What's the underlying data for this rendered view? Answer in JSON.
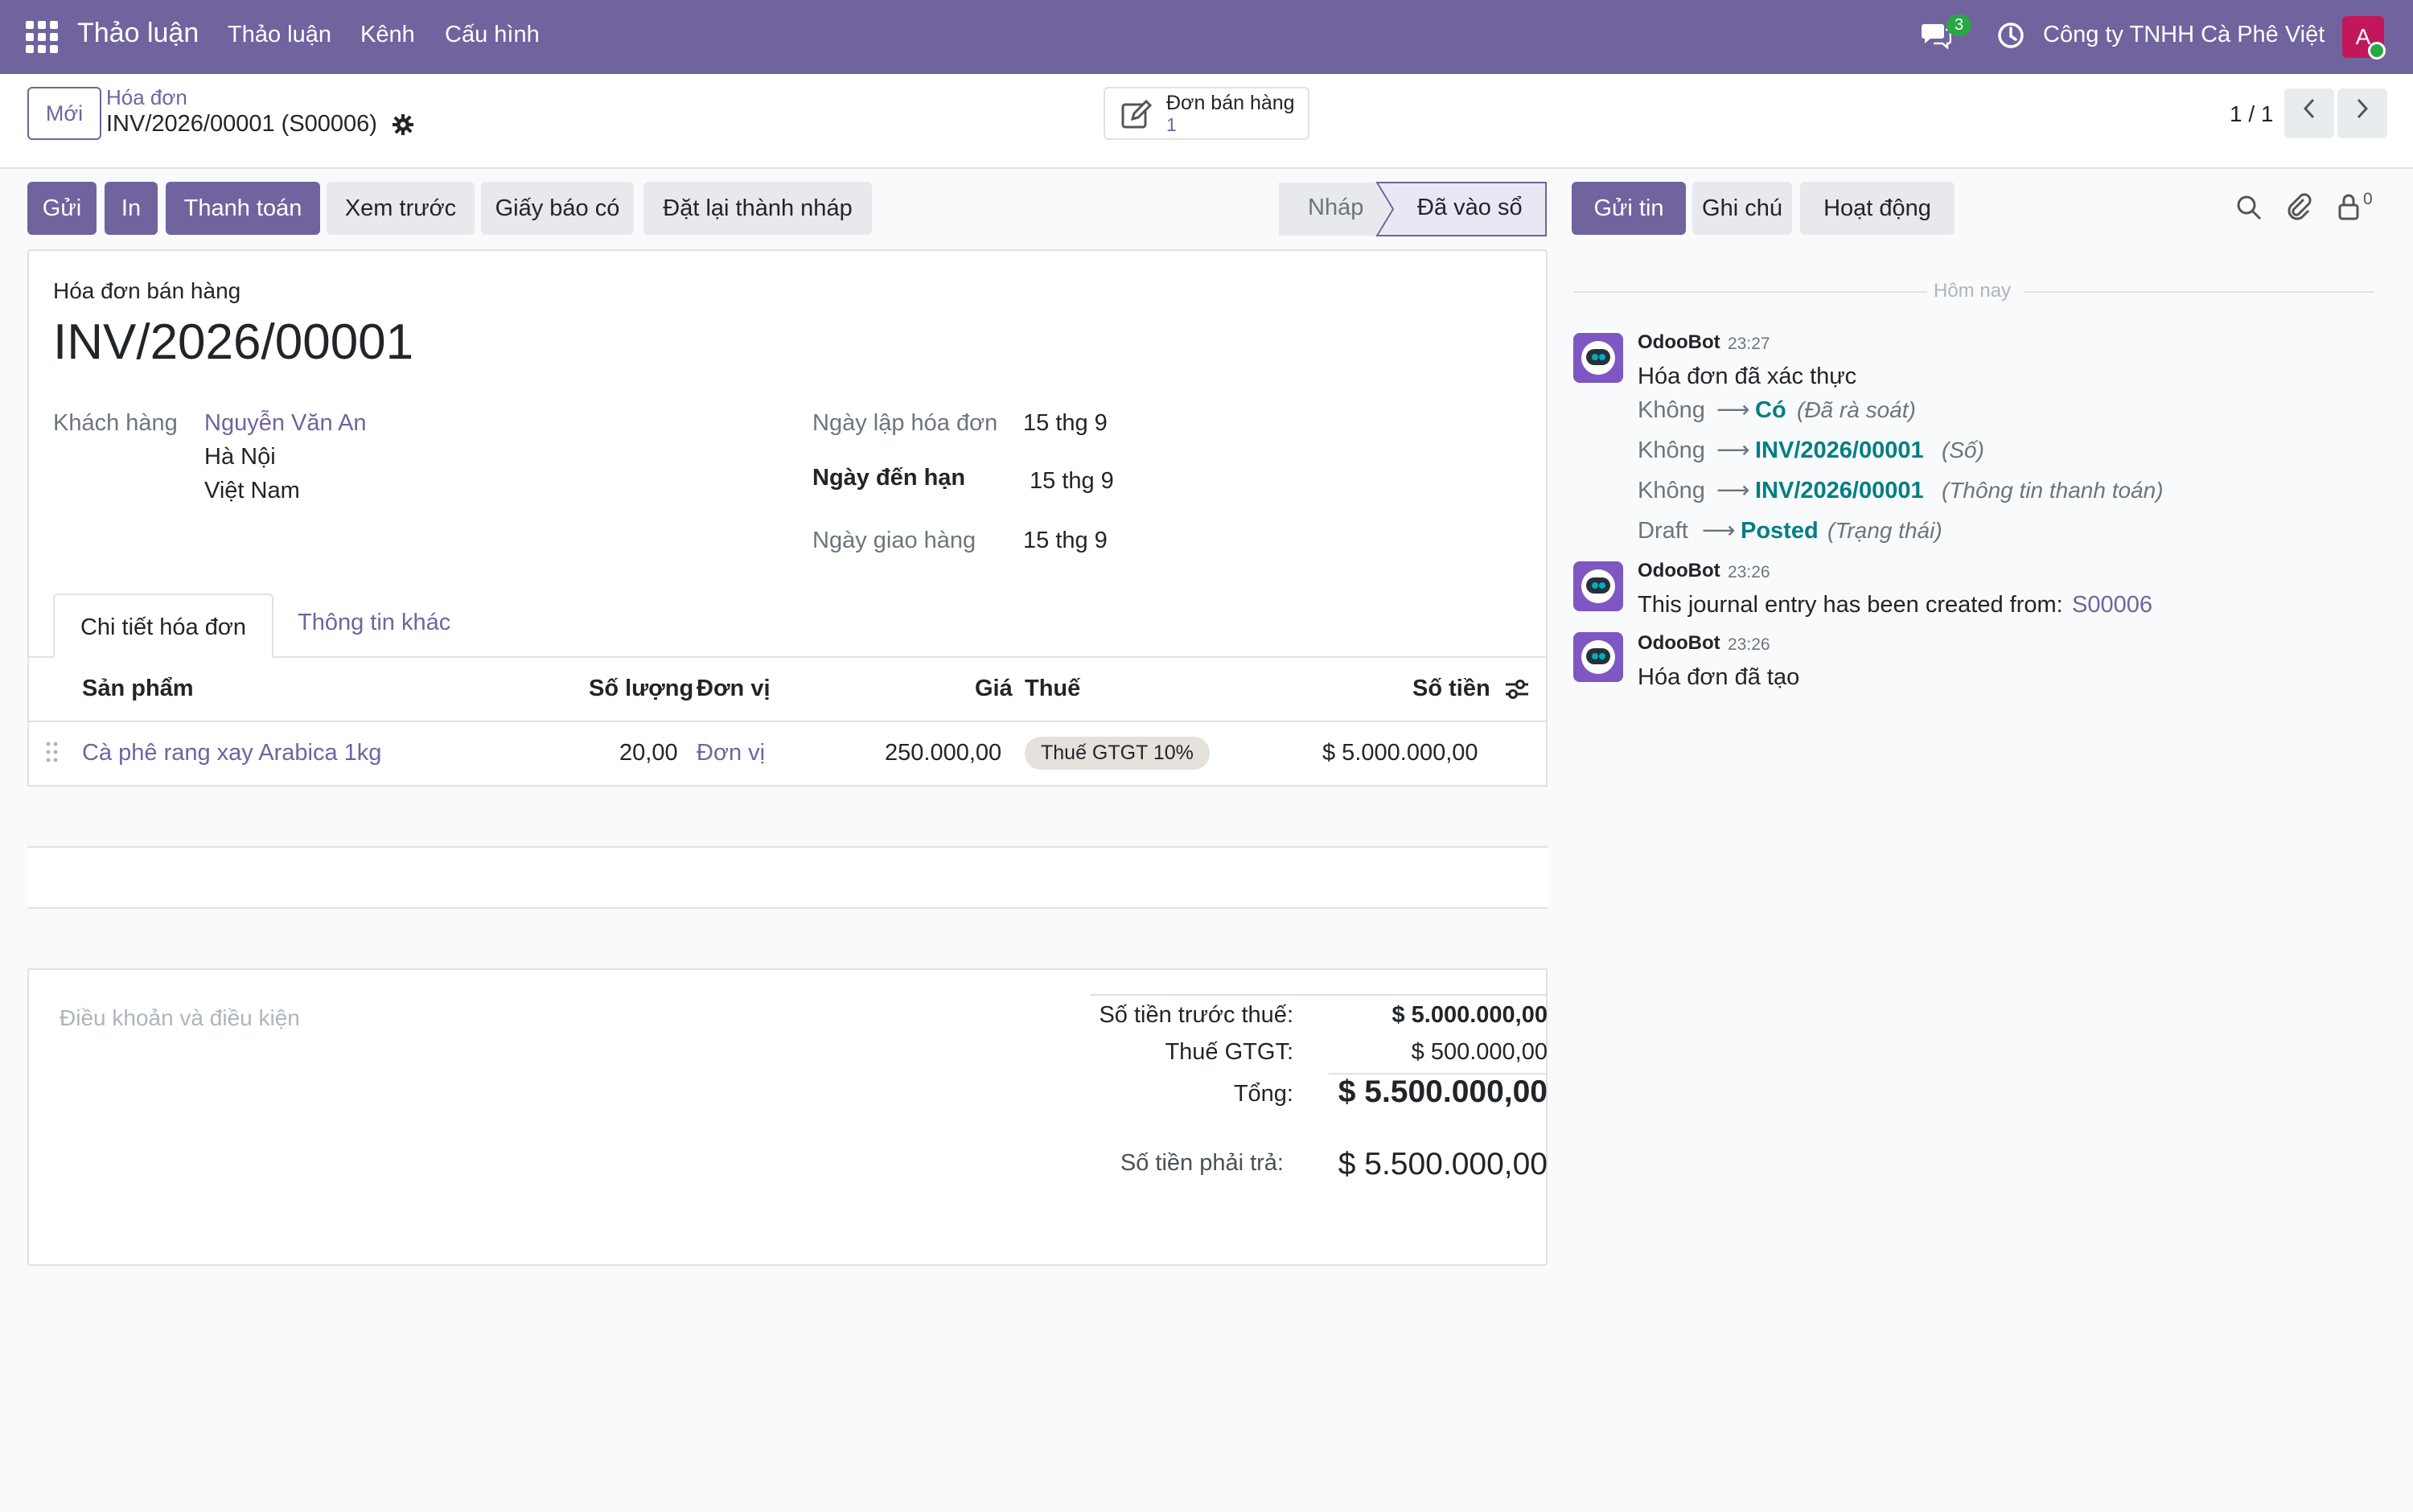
{
  "navbar": {
    "brand": "Thảo luận",
    "menu": [
      "Thảo luận",
      "Kênh",
      "Cấu hình"
    ],
    "message_count": "3",
    "company": "Công ty TNHH Cà Phê Việt",
    "avatar_letter": "A"
  },
  "control": {
    "new_button": "Mới",
    "breadcrumb_parent": "Hóa đơn",
    "breadcrumb_current": "INV/2026/00001 (S00006)",
    "smart_button_label": "Đơn bán hàng",
    "smart_button_count": "1",
    "pager": "1 / 1"
  },
  "actions": [
    "Gửi",
    "In",
    "Thanh toán",
    "Xem trước",
    "Giấy báo có",
    "Đặt lại thành nháp"
  ],
  "status": {
    "draft": "Nháp",
    "posted": "Đã vào sổ"
  },
  "form": {
    "doc_type": "Hóa đơn bán hàng",
    "number": "INV/2026/00001",
    "customer_label": "Khách hàng",
    "customer_name": "Nguyễn Văn An",
    "customer_city": "Hà Nội",
    "customer_country": "Việt Nam",
    "invoice_date_label": "Ngày lập hóa đơn",
    "invoice_date": "15 thg 9",
    "due_date_label": "Ngày đến hạn",
    "due_date": "15 thg 9",
    "delivery_date_label": "Ngày giao hàng",
    "delivery_date": "15 thg 9",
    "tabs": [
      "Chi tiết hóa đơn",
      "Thông tin khác"
    ],
    "columns": {
      "product": "Sản phẩm",
      "qty": "Số lượng",
      "uom": "Đơn vị",
      "price": "Giá",
      "tax": "Thuế",
      "amount": "Số tiền"
    },
    "line": {
      "product": "Cà phê rang xay Arabica 1kg",
      "qty": "20,00",
      "uom": "Đơn vị",
      "price": "250.000,00",
      "tax": "Thuế GTGT 10%",
      "amount": "$ 5.000.000,00"
    },
    "terms_placeholder": "Điều khoản và điều kiện",
    "totals": {
      "untaxed_label": "Số tiền trước thuế:",
      "untaxed": "$ 5.000.000,00",
      "vat_label": "Thuế GTGT:",
      "vat": "$ 500.000,00",
      "total_label": "Tổng:",
      "total": "$ 5.500.000,00",
      "due_label": "Số tiền phải trả:",
      "due": "$ 5.500.000,00"
    }
  },
  "chatter": {
    "buttons": [
      "Gửi tin",
      "Ghi chú",
      "Hoạt động"
    ],
    "follower_count": "0",
    "today": "Hôm nay",
    "messages": [
      {
        "author": "OdooBot",
        "time": "23:27",
        "body": "Hóa đơn đã xác thực",
        "tracking": [
          {
            "old": "Không",
            "new": "Có",
            "field": "(Đã rà soát)"
          },
          {
            "old": "Không",
            "new": "INV/2026/00001",
            "field": "(Số)"
          },
          {
            "old": "Không",
            "new": "INV/2026/00001",
            "field": "(Thông tin thanh toán)"
          },
          {
            "old": "Draft",
            "new": "Posted",
            "field": "(Trạng thái)"
          }
        ]
      },
      {
        "author": "OdooBot",
        "time": "23:26",
        "body": "This journal entry has been created from:",
        "link": "S00006"
      },
      {
        "author": "OdooBot",
        "time": "23:26",
        "body": "Hóa đơn đã tạo"
      }
    ]
  }
}
